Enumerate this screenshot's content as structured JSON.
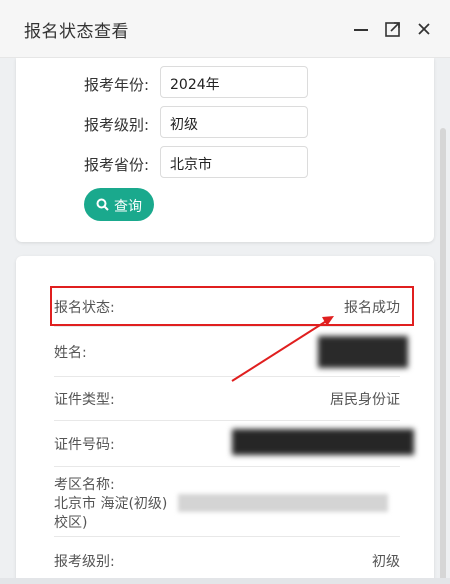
{
  "window": {
    "title": "报名状态查看",
    "controls": [
      "minimize-icon",
      "expand-icon",
      "close-icon"
    ]
  },
  "query_form": {
    "fields": [
      {
        "label": "报考年份:",
        "value": "2024年"
      },
      {
        "label": "报考级别:",
        "value": "初级"
      },
      {
        "label": "报考省份:",
        "value": "北京市"
      }
    ],
    "query_button": {
      "label": "查询",
      "icon": "search-icon"
    }
  },
  "result": {
    "status_label": "报名状态:",
    "status_value": "报名成功",
    "name_label": "姓名:",
    "id_type_label": "证件类型:",
    "id_type_value": "居民身份证",
    "id_number_label": "证件号码:",
    "exam_area_label": "考区名称:",
    "exam_area_value_line1": "北京市 海淀(初级)",
    "exam_area_value_line2": "校区)",
    "level_label": "报考级别:",
    "level_value": "初级"
  },
  "colors": {
    "accent": "#1aa98d",
    "highlight": "#e01f1f"
  }
}
